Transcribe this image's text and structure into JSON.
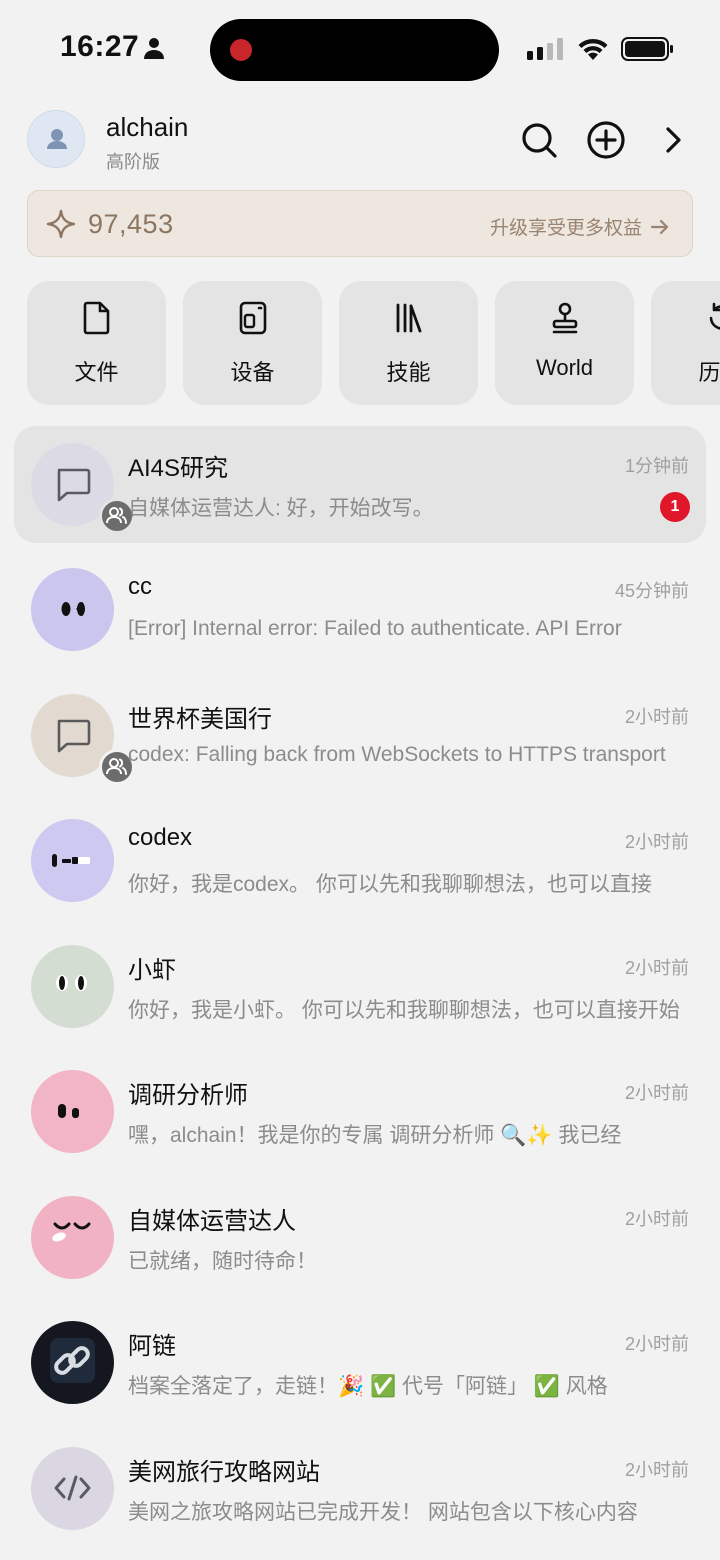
{
  "status_bar": {
    "time": "16:27"
  },
  "header": {
    "username": "alchain",
    "plan": "高阶版"
  },
  "points": {
    "value": "97,453",
    "upgrade_label": "升级享受更多权益",
    "accent_color": "#8d7660"
  },
  "shortcuts": [
    {
      "label": "文件",
      "icon": "file-icon"
    },
    {
      "label": "设备",
      "icon": "device-icon"
    },
    {
      "label": "技能",
      "icon": "library-icon"
    },
    {
      "label": "World",
      "icon": "stamp-icon"
    },
    {
      "label": "历史",
      "icon": "history-icon"
    }
  ],
  "chats": [
    {
      "name": "AI4S研究",
      "time": "1分钟前",
      "preview": "自媒体运营达人: 好，开始改写。",
      "unread": "1",
      "avatar": "chat-bubble-icon",
      "group": true
    },
    {
      "name": "cc",
      "time": "45分钟前",
      "preview": "[Error] Internal error: Failed to authenticate. API Error",
      "avatar": "purple-face"
    },
    {
      "name": "世界杯美国行",
      "time": "2小时前",
      "preview": "codex: Falling back from WebSockets to HTTPS transport",
      "avatar": "chat-bubble-icon",
      "group": true
    },
    {
      "name": "codex",
      "time": "2小时前",
      "preview": "你好，我是codex。 你可以先和我聊聊想法，也可以直接",
      "avatar": "lavender-face"
    },
    {
      "name": "小虾",
      "time": "2小时前",
      "preview": "你好，我是小虾。 你可以先和我聊聊想法，也可以直接开始",
      "avatar": "green-face"
    },
    {
      "name": "调研分析师",
      "time": "2小时前",
      "preview": "嘿，alchain！我是你的专属 调研分析师 🔍✨ 我已经",
      "avatar": "pink-face"
    },
    {
      "name": "自媒体运营达人",
      "time": "2小时前",
      "preview": "已就绪，随时待命！",
      "avatar": "pink-smile-face"
    },
    {
      "name": "阿链",
      "time": "2小时前",
      "preview": "档案全落定了，走链！🎉 ✅ 代号「阿链」 ✅ 风格",
      "avatar": "chain-link-icon"
    },
    {
      "name": "美网旅行攻略网站",
      "time": "2小时前",
      "preview": "美网之旅攻略网站已完成开发！ 网站包含以下核心内容",
      "avatar": "code-icon"
    }
  ]
}
